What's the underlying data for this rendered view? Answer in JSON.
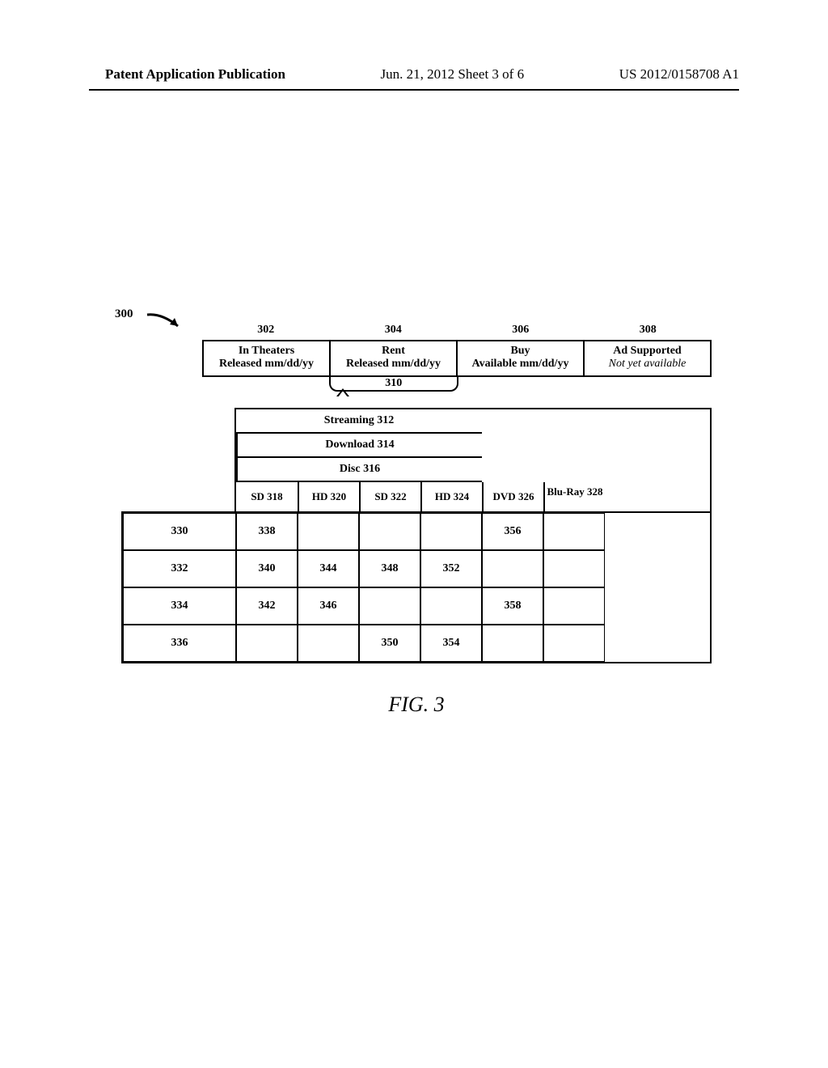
{
  "header": {
    "left": "Patent Application Publication",
    "mid": "Jun. 21, 2012  Sheet 3 of 6",
    "right": "US 2012/0158708 A1"
  },
  "figure": {
    "main_ref": "300",
    "tab_refs": [
      "302",
      "304",
      "306",
      "308"
    ],
    "tabs": [
      {
        "line1": "In Theaters",
        "line2": "Released mm/dd/yy",
        "italic": false
      },
      {
        "line1": "Rent",
        "line2": "Released mm/dd/yy",
        "italic": false
      },
      {
        "line1": "Buy",
        "line2": "Available mm/dd/yy",
        "italic": false
      },
      {
        "line1": "Ad Supported",
        "line2": "Not yet available",
        "italic": true
      }
    ],
    "active_tab_ref": "310",
    "group_headers": [
      "Streaming 312",
      "Download 314",
      "Disc 316"
    ],
    "col_headers": [
      "SD 318",
      "HD 320",
      "SD 322",
      "HD 324",
      "DVD 326",
      "Blu-Ray 328"
    ],
    "rows": [
      {
        "label": "330",
        "cells": [
          "338",
          "",
          "",
          "",
          "356",
          ""
        ]
      },
      {
        "label": "332",
        "cells": [
          "340",
          "344",
          "348",
          "352",
          "",
          ""
        ]
      },
      {
        "label": "334",
        "cells": [
          "342",
          "346",
          "",
          "",
          "358",
          ""
        ]
      },
      {
        "label": "336",
        "cells": [
          "",
          "",
          "350",
          "354",
          "",
          ""
        ]
      }
    ],
    "caption": "FIG. 3"
  }
}
